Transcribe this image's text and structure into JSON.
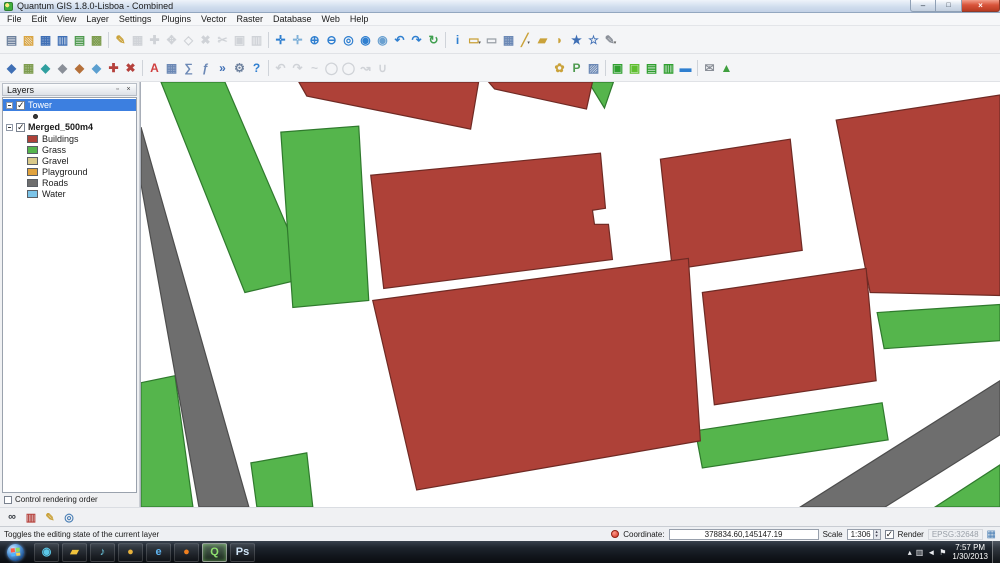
{
  "window": {
    "title": "Quantum GIS 1.8.0-Lisboa - Combined",
    "controls": {
      "minimize": "–",
      "maximize": "□",
      "close": "×"
    }
  },
  "menubar": {
    "items": [
      "File",
      "Edit",
      "View",
      "Layer",
      "Settings",
      "Plugins",
      "Vector",
      "Raster",
      "Database",
      "Web",
      "Help"
    ]
  },
  "toolbar1": {
    "groups": [
      [
        {
          "name": "new-project",
          "glyph": "▤",
          "color": "#6b7f9c"
        },
        {
          "name": "open-project",
          "glyph": "▧",
          "color": "#d9a440"
        },
        {
          "name": "save-project",
          "glyph": "▦",
          "color": "#3f6fb5"
        },
        {
          "name": "save-project-as",
          "glyph": "▥",
          "color": "#3f6fb5"
        },
        {
          "name": "new-print-composer",
          "glyph": "▤",
          "color": "#4e9a4e"
        },
        {
          "name": "composer-manager",
          "glyph": "▩",
          "color": "#7d9c4e"
        }
      ],
      [
        {
          "name": "toggle-editing",
          "glyph": "✎",
          "color": "#caa23a"
        },
        {
          "name": "save-edits",
          "glyph": "▦",
          "color": "#9aa0a8",
          "disabled": true
        },
        {
          "name": "add-feature",
          "glyph": "✚",
          "color": "#9aa0a8",
          "disabled": true
        },
        {
          "name": "move-feature",
          "glyph": "✥",
          "color": "#9aa0a8",
          "disabled": true
        },
        {
          "name": "node-tool",
          "glyph": "◇",
          "color": "#9aa0a8",
          "disabled": true
        },
        {
          "name": "delete-selected",
          "glyph": "✖",
          "color": "#9aa0a8",
          "disabled": true
        },
        {
          "name": "cut-features",
          "glyph": "✂",
          "color": "#9aa0a8",
          "disabled": true
        },
        {
          "name": "copy-features",
          "glyph": "▣",
          "color": "#9aa0a8",
          "disabled": true
        },
        {
          "name": "paste-features",
          "glyph": "▥",
          "color": "#9aa0a8",
          "disabled": true
        }
      ],
      [
        {
          "name": "pan-map",
          "glyph": "✛",
          "color": "#2f7fd0"
        },
        {
          "name": "pan-to-selection",
          "glyph": "✛",
          "color": "#7fb0d8"
        },
        {
          "name": "zoom-in",
          "glyph": "⊕",
          "color": "#2f7fd0"
        },
        {
          "name": "zoom-out",
          "glyph": "⊖",
          "color": "#2f7fd0"
        },
        {
          "name": "zoom-full",
          "glyph": "◎",
          "color": "#2f7fd0"
        },
        {
          "name": "zoom-to-selection",
          "glyph": "◉",
          "color": "#2f7fd0"
        },
        {
          "name": "zoom-to-layer",
          "glyph": "◉",
          "color": "#6aa0d0"
        },
        {
          "name": "zoom-last",
          "glyph": "↶",
          "color": "#2f7fd0"
        },
        {
          "name": "zoom-next",
          "glyph": "↷",
          "color": "#2f7fd0"
        },
        {
          "name": "refresh-map",
          "glyph": "↻",
          "color": "#3f9f4f"
        }
      ],
      [
        {
          "name": "identify-features",
          "glyph": "i",
          "color": "#2f7fd0"
        },
        {
          "name": "select-features",
          "glyph": "▭",
          "color": "#caa23a",
          "dd": true
        },
        {
          "name": "deselect-all",
          "glyph": "▭",
          "color": "#9aa0a8"
        },
        {
          "name": "open-attribute-table",
          "glyph": "▦",
          "color": "#6b88b5"
        },
        {
          "name": "measure-line",
          "glyph": "╱",
          "color": "#caa23a",
          "dd": true
        },
        {
          "name": "measure-area",
          "glyph": "▰",
          "color": "#caa23a"
        },
        {
          "name": "map-tips",
          "glyph": "◗",
          "color": "#caa23a"
        },
        {
          "name": "new-bookmark",
          "glyph": "★",
          "color": "#3f6fb5"
        },
        {
          "name": "show-bookmarks",
          "glyph": "☆",
          "color": "#3f6fb5"
        },
        {
          "name": "text-annotation",
          "glyph": "✎",
          "color": "#8a8f98",
          "dd": true
        }
      ]
    ]
  },
  "toolbar2": {
    "groups": [
      [
        {
          "name": "add-vector-layer",
          "glyph": "◆",
          "color": "#3f6fb5"
        },
        {
          "name": "add-raster-layer",
          "glyph": "▦",
          "color": "#7d9c4e"
        },
        {
          "name": "add-postgis-layer",
          "glyph": "◆",
          "color": "#2f9f9f"
        },
        {
          "name": "add-spatialite-layer",
          "glyph": "◆",
          "color": "#8a8f98"
        },
        {
          "name": "add-wms-layer",
          "glyph": "◆",
          "color": "#b5703a"
        },
        {
          "name": "add-wfs-layer",
          "glyph": "◆",
          "color": "#5b9fd0"
        },
        {
          "name": "new-shapefile-layer",
          "glyph": "✚",
          "color": "#b5413c"
        },
        {
          "name": "remove-layer",
          "glyph": "✖",
          "color": "#b5413c"
        }
      ],
      [
        {
          "name": "labeling",
          "glyph": "A",
          "color": "#d04040"
        },
        {
          "name": "layer-attribute-table",
          "glyph": "▦",
          "color": "#6b88b5"
        },
        {
          "name": "field-calculator",
          "glyph": "∑",
          "color": "#6b88b5"
        },
        {
          "name": "select-by-expression",
          "glyph": "ƒ",
          "color": "#6b88b5"
        },
        {
          "name": "python-console",
          "glyph": "»",
          "color": "#3f6fb5"
        },
        {
          "name": "plugin-manager",
          "glyph": "⚙",
          "color": "#6b7f9c"
        },
        {
          "name": "help-contents",
          "glyph": "?",
          "color": "#2f7fd0"
        }
      ],
      [
        {
          "name": "undo",
          "glyph": "↶",
          "color": "#9aa0a8",
          "disabled": true
        },
        {
          "name": "redo",
          "glyph": "↷",
          "color": "#9aa0a8",
          "disabled": true
        },
        {
          "name": "simplify-feature",
          "glyph": "~",
          "color": "#9aa0a8",
          "disabled": true
        },
        {
          "name": "add-ring",
          "glyph": "◯",
          "color": "#9aa0a8",
          "disabled": true
        },
        {
          "name": "add-part",
          "glyph": "◯",
          "color": "#9aa0a8",
          "disabled": true
        },
        {
          "name": "reshape-features",
          "glyph": "↝",
          "color": "#9aa0a8",
          "disabled": true
        },
        {
          "name": "merge-features",
          "glyph": "∪",
          "color": "#9aa0a8",
          "disabled": true
        }
      ]
    ],
    "right_groups": [
      [
        {
          "name": "ftools",
          "glyph": "✿",
          "color": "#caa23a"
        },
        {
          "name": "python-plugins",
          "glyph": "P",
          "color": "#4e9a4e"
        },
        {
          "name": "georeferencer",
          "glyph": "▨",
          "color": "#6b88b5"
        }
      ],
      [
        {
          "name": "gdal-tools",
          "glyph": "▣",
          "color": "#2f9f2f"
        },
        {
          "name": "raster-calculator",
          "glyph": "▣",
          "color": "#5fbf2f"
        },
        {
          "name": "interpolation",
          "glyph": "▤",
          "color": "#2f9f2f"
        },
        {
          "name": "zonal-statistics",
          "glyph": "▥",
          "color": "#2f9f2f"
        },
        {
          "name": "road-graph",
          "glyph": "▬",
          "color": "#2f7fd0"
        }
      ],
      [
        {
          "name": "mapserver-export",
          "glyph": "✉",
          "color": "#8a8f98"
        },
        {
          "name": "grass-tools",
          "glyph": "▲",
          "color": "#3f9f3f"
        }
      ]
    ]
  },
  "layers_panel": {
    "title": "Layers",
    "icons": {
      "float": "▫",
      "close": "×"
    },
    "layers": [
      {
        "name": "Tower",
        "checked": true,
        "selected": true,
        "type": "point"
      },
      {
        "name": "Merged_500m4",
        "checked": true,
        "legend": [
          "Buildings",
          "Grass",
          "Gravel",
          "Playground",
          "Roads",
          "Water"
        ]
      }
    ],
    "footer": "Control rendering order"
  },
  "bottom_toolbar": {
    "icons": [
      {
        "name": "binoculars",
        "glyph": "∞",
        "color": "#3a3f45"
      },
      {
        "name": "log-messages",
        "glyph": "▥",
        "color": "#b5413c"
      },
      {
        "name": "edit-pencil",
        "glyph": "✎",
        "color": "#caa23a"
      },
      {
        "name": "coordinate-capture",
        "glyph": "◎",
        "color": "#4a7fb5"
      }
    ]
  },
  "statusbar": {
    "hint": "Toggles the editing state of the current layer",
    "coordinate_label": "Coordinate:",
    "coordinate_value": "378834.60,145147.19",
    "scale_label": "Scale",
    "scale_value": "1:306",
    "spinner_up": "▲",
    "spinner_down": "▼",
    "render_label": "Render",
    "epsg_label": "EPSG:32648",
    "crs_icon": "▦"
  },
  "taskbar": {
    "icons": [
      {
        "name": "media-player",
        "glyph": "◉",
        "color": "#5bc8e8"
      },
      {
        "name": "explorer",
        "glyph": "▰",
        "color": "#f0c23c"
      },
      {
        "name": "itunes",
        "glyph": "♪",
        "color": "#6fd0e8"
      },
      {
        "name": "chrome",
        "glyph": "●",
        "color": "#e8b23c"
      },
      {
        "name": "internet-explorer",
        "glyph": "e",
        "color": "#5fb3ef"
      },
      {
        "name": "firefox",
        "glyph": "●",
        "color": "#ef7f1f"
      },
      {
        "name": "qgis",
        "glyph": "Q",
        "color": "#8fe06f",
        "active": true
      },
      {
        "name": "photoshop",
        "glyph": "Ps",
        "color": "#cfe3f5"
      }
    ],
    "tray": [
      {
        "name": "show-hidden-icons",
        "glyph": "▴"
      },
      {
        "name": "network",
        "glyph": "▥"
      },
      {
        "name": "volume",
        "glyph": "◄"
      },
      {
        "name": "action-center",
        "glyph": "⚑"
      }
    ],
    "clock_time": "7:57 PM",
    "clock_date": "1/30/2013"
  },
  "map": {
    "background": "#ffffff",
    "classes": {
      "Buildings": {
        "fill": "#ae4138",
        "stroke": "#6f2a24"
      },
      "Grass": {
        "fill": "#55b54c",
        "stroke": "#2f7a2d"
      },
      "Gravel": {
        "fill": "#d9c98a",
        "stroke": "#9a8c55"
      },
      "Playground": {
        "fill": "#e0a23e",
        "stroke": "#9a6d22"
      },
      "Roads": {
        "fill": "#6e6e6e",
        "stroke": "#4d4d4d"
      },
      "Water": {
        "fill": "#7cc4e8",
        "stroke": "#4a8fb5"
      }
    },
    "polygons": [
      {
        "class": "Grass",
        "points": [
          [
            20,
            0
          ],
          [
            84,
            0
          ],
          [
            168,
            195
          ],
          [
            104,
            210
          ]
        ]
      },
      {
        "class": "Grass",
        "points": [
          [
            140,
            50
          ],
          [
            218,
            44
          ],
          [
            228,
            218
          ],
          [
            152,
            225
          ]
        ]
      },
      {
        "class": "Grass",
        "points": [
          [
            448,
            0
          ],
          [
            473,
            0
          ],
          [
            464,
            26
          ]
        ]
      },
      {
        "class": "Grass",
        "points": [
          [
            555,
            348
          ],
          [
            742,
            320
          ],
          [
            748,
            357
          ],
          [
            562,
            385
          ]
        ]
      },
      {
        "class": "Grass",
        "points": [
          [
            737,
            230
          ],
          [
            860,
            222
          ],
          [
            860,
            258
          ],
          [
            744,
            266
          ]
        ]
      },
      {
        "class": "Grass",
        "points": [
          [
            0,
            300
          ],
          [
            34,
            293
          ],
          [
            52,
            424
          ],
          [
            0,
            424
          ]
        ]
      },
      {
        "class": "Grass",
        "points": [
          [
            110,
            380
          ],
          [
            166,
            370
          ],
          [
            172,
            424
          ],
          [
            116,
            424
          ]
        ]
      },
      {
        "class": "Grass",
        "points": [
          [
            795,
            424
          ],
          [
            860,
            382
          ],
          [
            860,
            424
          ]
        ]
      },
      {
        "class": "Roads",
        "points": [
          [
            0,
            45
          ],
          [
            108,
            424
          ],
          [
            58,
            424
          ],
          [
            0,
            102
          ]
        ]
      },
      {
        "class": "Roads",
        "points": [
          [
            660,
            424
          ],
          [
            860,
            298
          ],
          [
            860,
            352
          ],
          [
            745,
            424
          ]
        ]
      },
      {
        "class": "Buildings",
        "points": [
          [
            158,
            0
          ],
          [
            338,
            0
          ],
          [
            330,
            47
          ],
          [
            166,
            14
          ]
        ]
      },
      {
        "class": "Buildings",
        "points": [
          [
            348,
            0
          ],
          [
            452,
            0
          ],
          [
            446,
            27
          ],
          [
            354,
            7
          ]
        ]
      },
      {
        "class": "Buildings",
        "points": [
          [
            230,
            93
          ],
          [
            460,
            71
          ],
          [
            465,
            126
          ],
          [
            452,
            128
          ],
          [
            454,
            142
          ],
          [
            468,
            142
          ],
          [
            472,
            177
          ],
          [
            243,
            206
          ]
        ]
      },
      {
        "class": "Buildings",
        "points": [
          [
            520,
            77
          ],
          [
            650,
            57
          ],
          [
            662,
            168
          ],
          [
            532,
            187
          ]
        ]
      },
      {
        "class": "Buildings",
        "points": [
          [
            696,
            38
          ],
          [
            860,
            13
          ],
          [
            860,
            213
          ],
          [
            730,
            210
          ]
        ]
      },
      {
        "class": "Buildings",
        "points": [
          [
            232,
            218
          ],
          [
            548,
            176
          ],
          [
            560,
            358
          ],
          [
            276,
            407
          ]
        ]
      },
      {
        "class": "Buildings",
        "points": [
          [
            562,
            210
          ],
          [
            726,
            186
          ],
          [
            736,
            298
          ],
          [
            574,
            322
          ]
        ]
      }
    ]
  }
}
